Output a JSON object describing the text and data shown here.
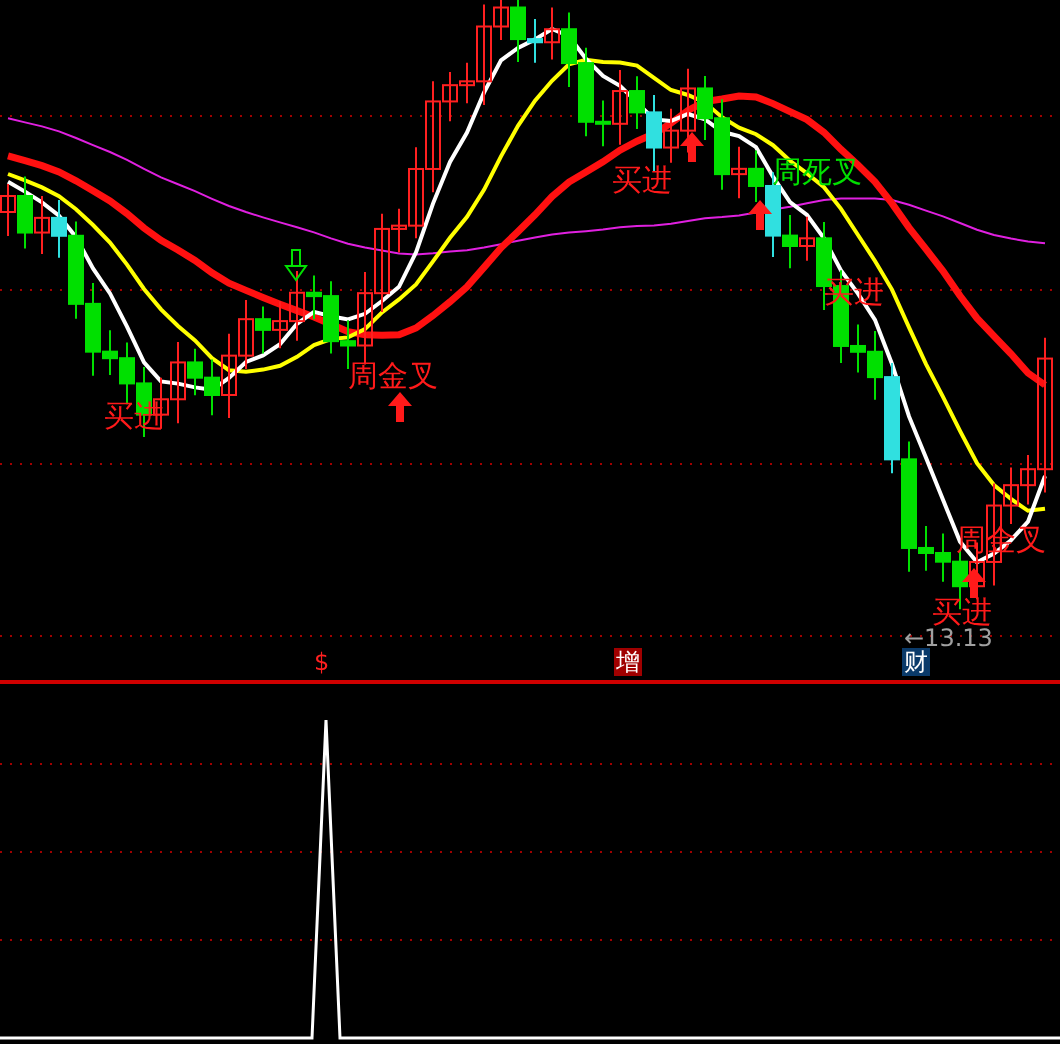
{
  "signals": [
    {
      "text": "买进",
      "kind": "buy"
    },
    {
      "text": "周金叉",
      "kind": "golden-cross"
    },
    {
      "text": "买进",
      "kind": "buy"
    },
    {
      "text": "周死叉",
      "kind": "death-cross"
    },
    {
      "text": "买进",
      "kind": "buy"
    },
    {
      "text": "买进",
      "kind": "buy"
    },
    {
      "text": "周金叉",
      "kind": "golden-cross"
    }
  ],
  "low_price_label": "←13.13",
  "markers": [
    {
      "label": "$",
      "kind": "plain"
    },
    {
      "label": "增",
      "kind": "red-box"
    },
    {
      "label": "财",
      "kind": "blue-box"
    }
  ]
}
